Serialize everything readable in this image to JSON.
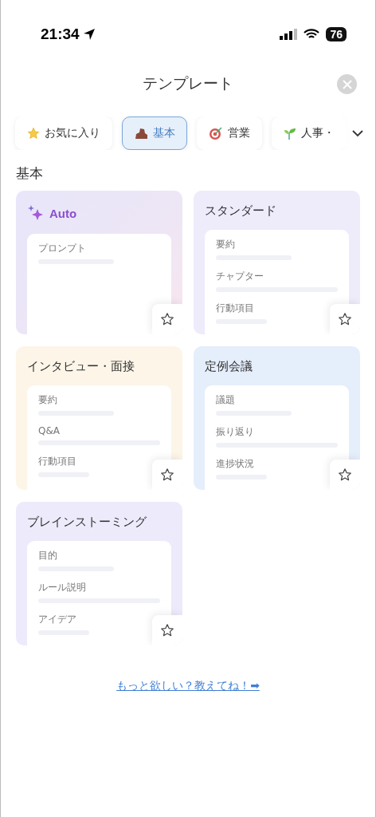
{
  "status_bar": {
    "time": "21:34",
    "battery": "76"
  },
  "header": {
    "title": "テンプレート"
  },
  "tabs": [
    {
      "label": "お気に入り",
      "kind": "star",
      "selected": false
    },
    {
      "label": "基本",
      "kind": "brick",
      "selected": true
    },
    {
      "label": "営業",
      "kind": "target",
      "selected": false
    },
    {
      "label": "人事・",
      "kind": "sprout",
      "selected": false
    }
  ],
  "section": {
    "title": "基本"
  },
  "templates": [
    {
      "kind": "auto",
      "title": "Auto",
      "color": "#ece6f6",
      "fields": [
        "プロンプト"
      ],
      "favorite": false
    },
    {
      "kind": "plain",
      "title": "スタンダード",
      "color": "#eeebfb",
      "fields": [
        "要約",
        "チャプター",
        "行動項目"
      ],
      "favorite": false
    },
    {
      "kind": "plain",
      "title": "インタビュー・面接",
      "color": "#fcf5e8",
      "fields": [
        "要約",
        "Q&A",
        "行動項目"
      ],
      "favorite": false
    },
    {
      "kind": "plain",
      "title": "定例会議",
      "color": "#e5eefb",
      "fields": [
        "議題",
        "振り返り",
        "進捗状況"
      ],
      "favorite": false
    },
    {
      "kind": "plain",
      "title": "ブレインストーミング",
      "color": "#edeafb",
      "fields": [
        "目的",
        "ルール説明",
        "アイデア"
      ],
      "favorite": false
    }
  ],
  "footer_link": "もっと欲しい？教えてね！➡"
}
